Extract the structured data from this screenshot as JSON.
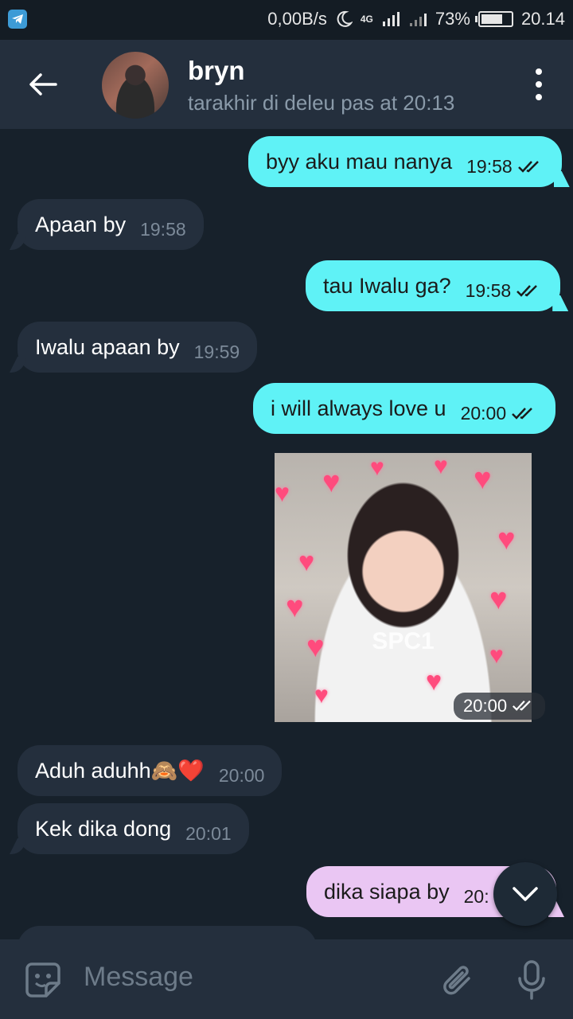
{
  "status_bar": {
    "net_speed": "0,00B/s",
    "network_label": "4G",
    "battery": "73%",
    "battery_level": 0.73,
    "time": "20.14"
  },
  "header": {
    "title": "bryn",
    "subtitle": "tarakhir di deleu pas  at 20:13"
  },
  "messages": [
    {
      "dir": "out",
      "text": "byy aku mau nanya",
      "time": "19:58"
    },
    {
      "dir": "in",
      "text": "Apaan by",
      "time": "19:58"
    },
    {
      "dir": "out",
      "text": "tau Iwalu ga?",
      "time": "19:58"
    },
    {
      "dir": "in",
      "text": "Iwalu apaan by",
      "time": "19:59"
    },
    {
      "dir": "out",
      "text": "i will always love u",
      "time": "20:00"
    },
    {
      "dir": "out",
      "type": "photo",
      "caption": "SPC1",
      "time": "20:00"
    },
    {
      "dir": "in",
      "text": "Aduh aduhh🙈❤️",
      "time": "20:00"
    },
    {
      "dir": "in",
      "text": "Kek dika dong",
      "time": "20:01"
    },
    {
      "dir": "out",
      "text": "dika siapa by",
      "time": "20:"
    }
  ],
  "composer": {
    "placeholder": "Message"
  },
  "colors": {
    "background": "#17212b",
    "header": "#242f3d",
    "incoming_bubble": "#242f3d",
    "outgoing_bubble": "#5ff2f6",
    "outgoing_bubble_alt": "#eac6f3"
  },
  "icons": [
    "telegram-icon",
    "moon-icon",
    "signal-icon",
    "battery-icon",
    "back-arrow-icon",
    "more-vert-icon",
    "double-check-icon",
    "chevron-down-icon",
    "sticker-icon",
    "attach-icon",
    "mic-icon"
  ]
}
